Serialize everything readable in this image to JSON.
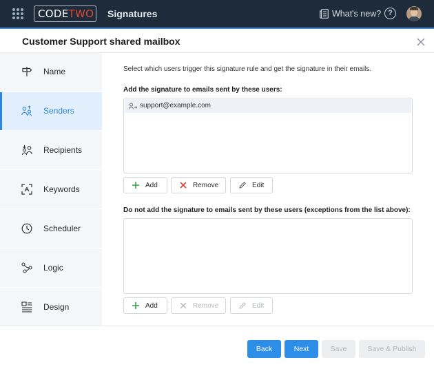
{
  "topbar": {
    "logo_main": "CODE",
    "logo_accent": "TWO",
    "app_title": "Signatures",
    "whats_new": "What's new?",
    "help_glyph": "?"
  },
  "header": {
    "title": "Customer Support shared mailbox"
  },
  "sidebar": {
    "items": [
      {
        "label": "Name",
        "icon": "signpost-icon"
      },
      {
        "label": "Senders",
        "icon": "senders-icon",
        "active": true
      },
      {
        "label": "Recipients",
        "icon": "recipients-icon"
      },
      {
        "label": "Keywords",
        "icon": "keywords-icon"
      },
      {
        "label": "Scheduler",
        "icon": "clock-icon"
      },
      {
        "label": "Logic",
        "icon": "logic-icon"
      },
      {
        "label": "Design",
        "icon": "design-icon"
      }
    ]
  },
  "main": {
    "intro": "Select which users trigger this signature rule and get the signature in their emails.",
    "include_section": {
      "label": "Add the signature to emails sent by these users:",
      "users": [
        "support@example.com"
      ],
      "buttons": {
        "add": "Add",
        "remove": "Remove",
        "edit": "Edit"
      }
    },
    "exclude_section": {
      "label": "Do not add the signature to emails sent by these users (exceptions from the list above):",
      "users": [],
      "buttons": {
        "add": "Add",
        "remove": "Remove",
        "edit": "Edit"
      }
    }
  },
  "footer": {
    "back": "Back",
    "next": "Next",
    "save": "Save",
    "save_publish": "Save & Publish"
  },
  "colors": {
    "topbar": "#1d2b3a",
    "accent": "#2d8ee8",
    "logo_accent": "#e04a36",
    "add_icon": "#3aa54a",
    "remove_icon": "#d9432f"
  }
}
